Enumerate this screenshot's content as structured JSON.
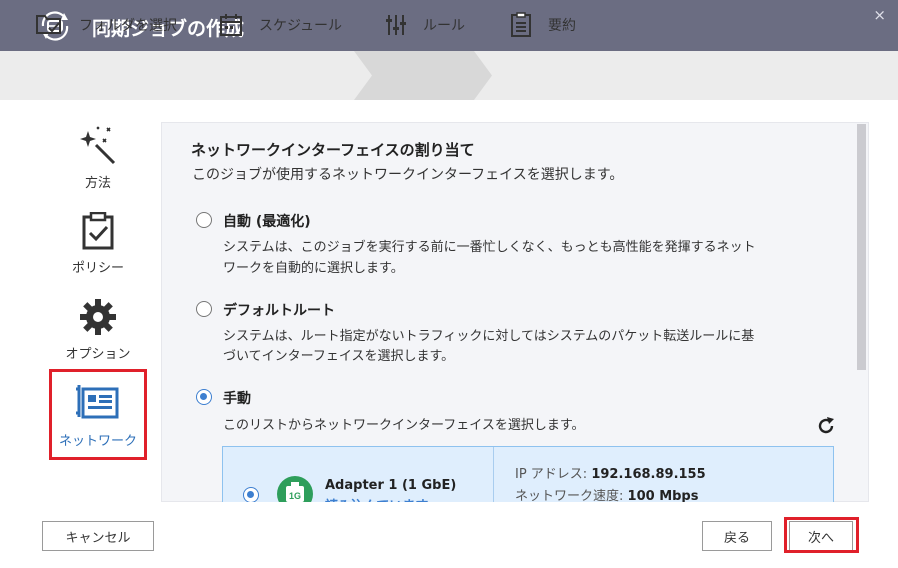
{
  "window": {
    "title": "同期ジョブの作成",
    "close_glyph": "×"
  },
  "steps": [
    {
      "label": "フォルダを選択",
      "icon": "folder-check-icon"
    },
    {
      "label": "スケジュール",
      "icon": "calendar-icon"
    },
    {
      "label": "ルール",
      "icon": "sliders-icon",
      "active": true
    },
    {
      "label": "要約",
      "icon": "clipboard-list-icon"
    }
  ],
  "sidebar": {
    "items": [
      {
        "label": "方法",
        "icon": "magic-wand-icon"
      },
      {
        "label": "ポリシー",
        "icon": "clipboard-check-icon"
      },
      {
        "label": "オプション",
        "icon": "gear-icon"
      },
      {
        "label": "ネットワーク",
        "icon": "network-card-icon",
        "active": true
      }
    ]
  },
  "content": {
    "title": "ネットワークインターフェイスの割り当て",
    "description": "このジョブが使用するネットワークインターフェイスを選択します。",
    "options": [
      {
        "title": "自動 (最適化)",
        "desc_line1": "システムは、このジョブを実行する前に一番忙しくなく、もっとも高性能を発揮するネット",
        "desc_line2": "ワークを自動的に選択します。",
        "checked": false
      },
      {
        "title": "デフォルトルート",
        "desc_line1": "システムは、ルート指定がないトラフィックに対してはシステムのパケット転送ルールに基",
        "desc_line2": "づいてインターフェイスを選択します。",
        "checked": false
      },
      {
        "title": "手動",
        "desc_line1": "このリストからネットワークインターフェイスを選択します。",
        "checked": true
      }
    ],
    "adapter": {
      "name": "Adapter 1 (1 GbE)",
      "status": "読み込んでいます",
      "badge": "1G",
      "ip_label": "IP アドレス:",
      "ip_value": "192.168.89.155",
      "speed_label": "ネットワーク速度:",
      "speed_value": "100 Mbps",
      "selected": true
    }
  },
  "buttons": {
    "cancel": "キャンセル",
    "back": "戻る",
    "next": "次へ"
  },
  "colors": {
    "titlebar": "#6b6d82",
    "accent": "#3d7fd0",
    "highlight": "#e0202a",
    "adapter_icon": "#2e9e5b"
  }
}
